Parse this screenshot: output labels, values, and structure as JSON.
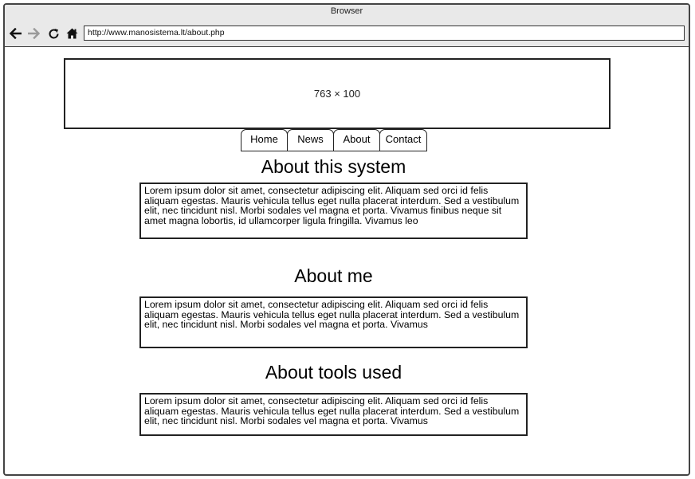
{
  "window": {
    "title": "Browser"
  },
  "toolbar": {
    "icons": [
      "back-arrow-icon",
      "forward-arrow-icon",
      "reload-icon",
      "home-icon"
    ],
    "url": "http://www.manosistema.lt/about.php"
  },
  "banner": {
    "placeholder_text": "763 × 100"
  },
  "nav": {
    "tabs": [
      {
        "label": "Home"
      },
      {
        "label": "News"
      },
      {
        "label": "About"
      },
      {
        "label": "Contact"
      }
    ]
  },
  "sections": [
    {
      "heading": "About this system",
      "body": "Lorem ipsum dolor sit amet, consectetur adipiscing elit. Aliquam sed orci id felis aliquam egestas. Mauris vehicula tellus eget nulla placerat interdum. Sed a vestibulum elit, nec tincidunt nisl. Morbi sodales vel magna et porta. Vivamus finibus neque sit amet magna lobortis, id ullamcorper ligula fringilla. Vivamus leo"
    },
    {
      "heading": "About me",
      "body": "Lorem ipsum dolor sit amet, consectetur adipiscing elit. Aliquam sed orci id felis aliquam egestas. Mauris vehicula tellus eget nulla placerat interdum. Sed a vestibulum elit, nec tincidunt nisl. Morbi sodales vel magna et porta. Vivamus"
    },
    {
      "heading": "About tools used",
      "body": "Lorem ipsum dolor sit amet, consectetur adipiscing elit. Aliquam sed orci id felis aliquam egestas. Mauris vehicula tellus eget nulla placerat interdum. Sed a vestibulum elit, nec tincidunt nisl. Morbi sodales vel magna et porta. Vivamus"
    }
  ]
}
